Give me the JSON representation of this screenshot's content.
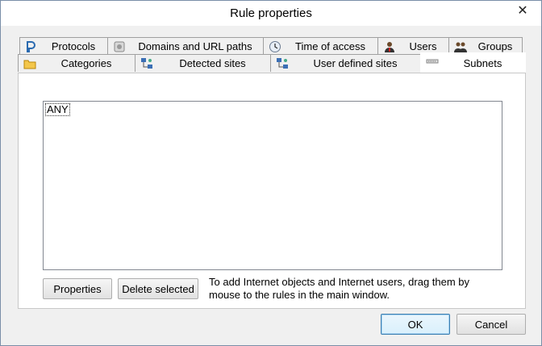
{
  "window": {
    "title": "Rule properties"
  },
  "tabs_row1": [
    {
      "label": "Protocols",
      "icon": "protocols-icon"
    },
    {
      "label": "Domains and URL paths",
      "icon": "domains-icon"
    },
    {
      "label": "Time of access",
      "icon": "time-icon"
    },
    {
      "label": "Users",
      "icon": "user-icon"
    },
    {
      "label": "Groups",
      "icon": "groups-icon"
    }
  ],
  "tabs_row2": [
    {
      "label": "Categories",
      "icon": "folder-icon"
    },
    {
      "label": "Detected sites",
      "icon": "network-icon"
    },
    {
      "label": "User defined sites",
      "icon": "network-icon"
    },
    {
      "label": "Subnets",
      "icon": "subnet-icon",
      "active": true
    }
  ],
  "subnets": {
    "items": [
      "ANY"
    ],
    "properties_label": "Properties",
    "delete_label": "Delete selected",
    "hint": "To add Internet objects and Internet users, drag them by mouse to the rules in the main window."
  },
  "footer": {
    "ok_label": "OK",
    "cancel_label": "Cancel"
  },
  "colors": {
    "panel_bg": "#ffffff",
    "dialog_bg": "#f0f0f0",
    "default_border": "#3c7fb1"
  }
}
